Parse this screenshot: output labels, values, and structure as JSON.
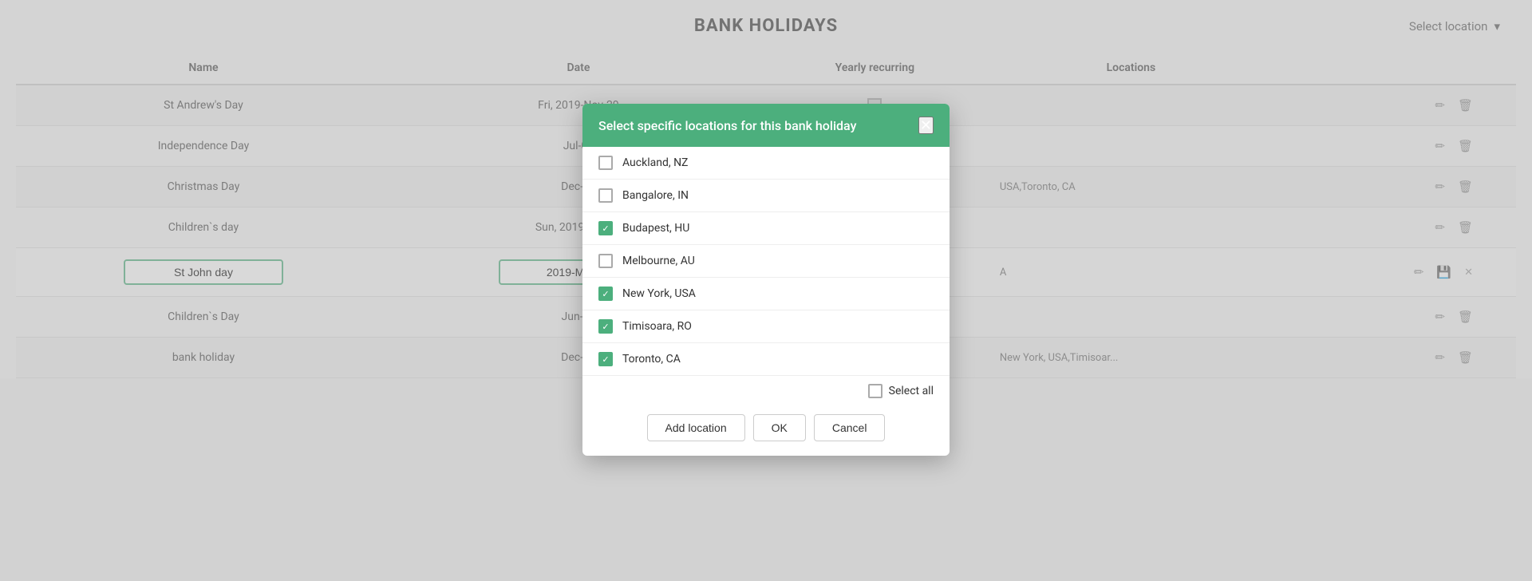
{
  "page": {
    "title": "BANK HOLIDAYS",
    "selectLocationPlaceholder": "Select location",
    "selectLocationArrow": "▾"
  },
  "table": {
    "columns": [
      "Name",
      "Date",
      "Yearly recurring",
      "Locations",
      ""
    ],
    "rows": [
      {
        "name": "St Andrew's Day",
        "date": "Fri, 2019-Nov-29",
        "recurring": "partial",
        "locations": "",
        "editing": false
      },
      {
        "name": "Independence Day",
        "date": "Jul-04",
        "recurring": "checked",
        "locations": "",
        "editing": false
      },
      {
        "name": "Christmas Day",
        "date": "Dec-25",
        "recurring": "checked",
        "locations": "USA,Toronto, CA",
        "editing": false
      },
      {
        "name": "Children`s day",
        "date": "Sun, 2019-Jun-09",
        "recurring": "partial",
        "locations": "",
        "editing": false
      },
      {
        "name": "St John day",
        "date": "2019-Mar-28",
        "recurring": "green",
        "locations": "A",
        "editing": true
      },
      {
        "name": "Children`s Day",
        "date": "Jun-01",
        "recurring": "checked",
        "locations": "",
        "editing": false
      },
      {
        "name": "bank holiday",
        "date": "Dec-16",
        "recurring": "checked",
        "locations": "New York, USA,Timisoar...",
        "editing": false
      }
    ]
  },
  "modal": {
    "title": "Select specific locations for this bank holiday",
    "closeLabel": "✕",
    "locations": [
      {
        "name": "Auckland, NZ",
        "checked": false
      },
      {
        "name": "Bangalore, IN",
        "checked": false
      },
      {
        "name": "Budapest, HU",
        "checked": true
      },
      {
        "name": "Melbourne, AU",
        "checked": false
      },
      {
        "name": "New York, USA",
        "checked": true
      },
      {
        "name": "Timisoara, RO",
        "checked": true
      },
      {
        "name": "Toronto, CA",
        "checked": true
      }
    ],
    "selectAllLabel": "Select all",
    "buttons": {
      "addLocation": "Add location",
      "ok": "OK",
      "cancel": "Cancel"
    }
  }
}
